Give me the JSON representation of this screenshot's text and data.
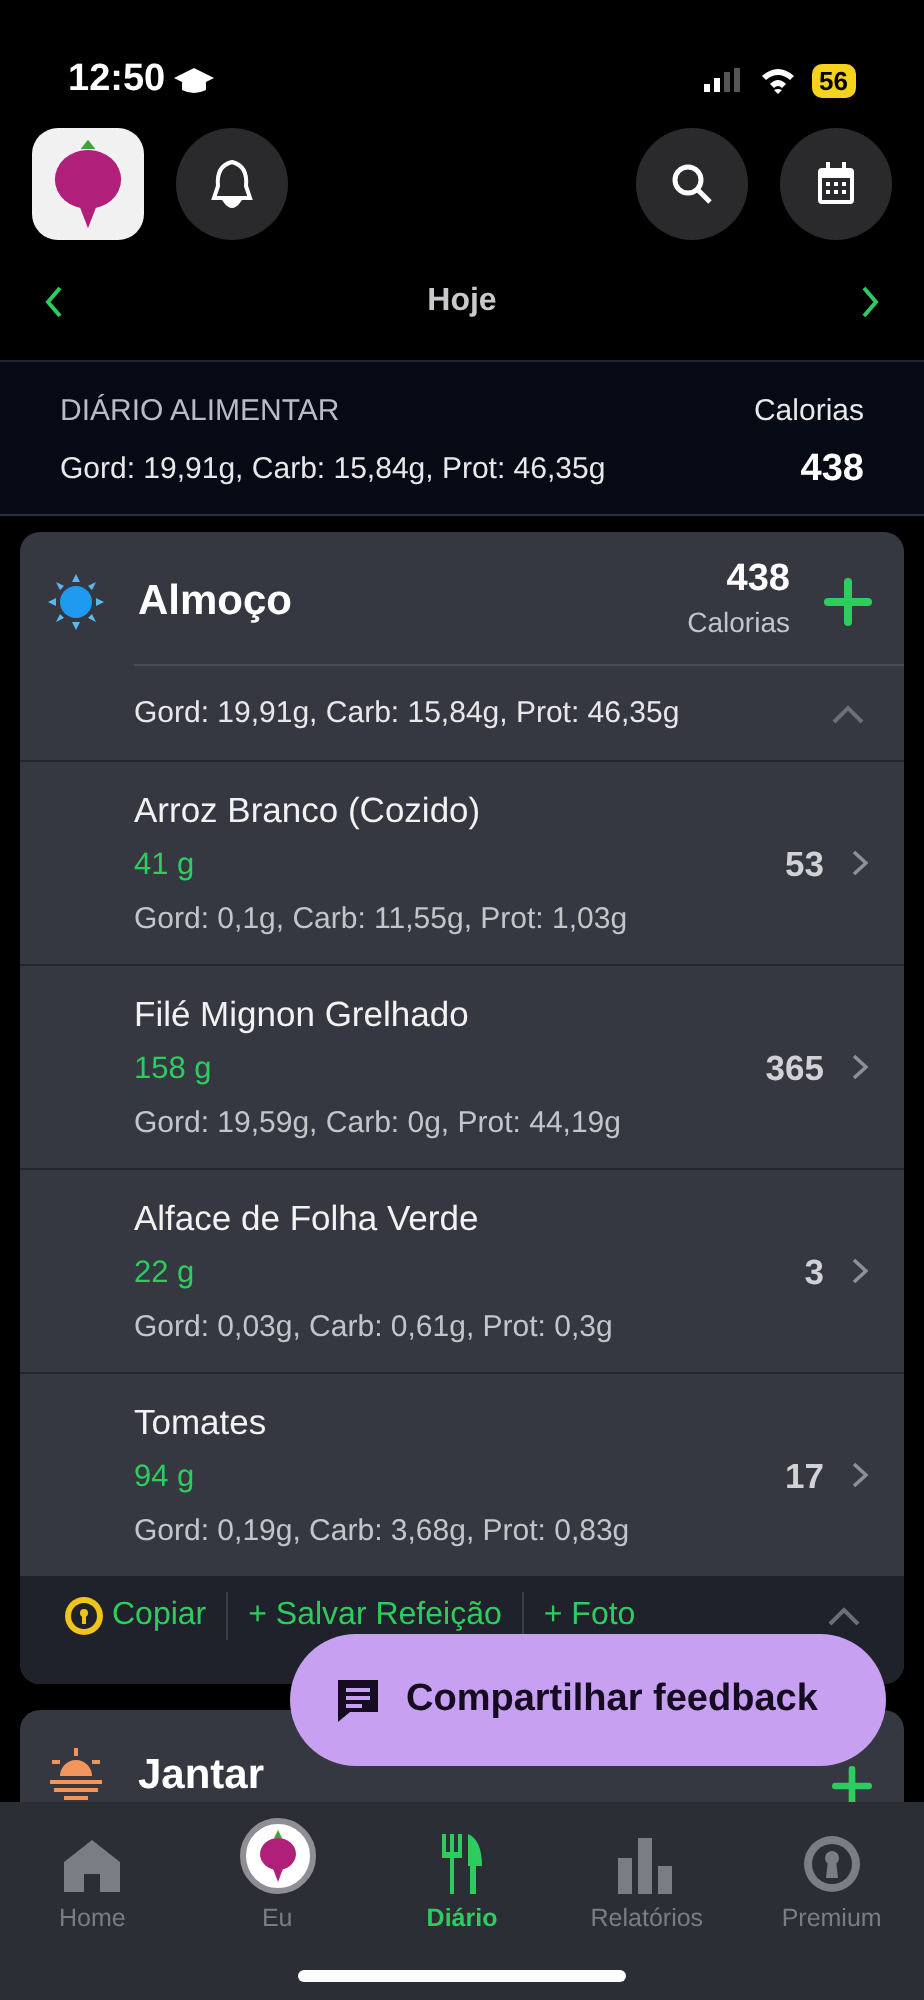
{
  "status_bar": {
    "time": "12:50",
    "battery": "56"
  },
  "date_nav": {
    "label": "Hoje"
  },
  "summary": {
    "title": "DIÁRIO ALIMENTAR",
    "macros": "Gord: 19,91g, Carb: 15,84g, Prot: 46,35g",
    "calories_label": "Calorias",
    "calories": "438"
  },
  "meals": [
    {
      "name": "Almoço",
      "kind": "lunch",
      "calories": "438",
      "calories_label": "Calorias",
      "expanded": true,
      "macros": "Gord: 19,91g, Carb: 15,84g, Prot: 46,35g",
      "foods": [
        {
          "name": "Arroz Branco (Cozido)",
          "amount": "41 g",
          "macros": "Gord: 0,1g, Carb: 11,55g, Prot: 1,03g",
          "calories": "53"
        },
        {
          "name": "Filé Mignon Grelhado",
          "amount": "158 g",
          "macros": "Gord: 19,59g, Carb: 0g, Prot: 44,19g",
          "calories": "365"
        },
        {
          "name": "Alface de Folha Verde",
          "amount": "22 g",
          "macros": "Gord: 0,03g, Carb: 0,61g, Prot: 0,3g",
          "calories": "3"
        },
        {
          "name": "Tomates",
          "amount": "94 g",
          "macros": "Gord: 0,19g, Carb: 3,68g, Prot: 0,83g",
          "calories": "17"
        }
      ],
      "actions": [
        "Copiar",
        "+ Salvar Refeição",
        "+ Foto"
      ]
    },
    {
      "name": "Jantar",
      "kind": "dinner",
      "expanded": false
    }
  ],
  "feedback_button": "Compartilhar feedback",
  "tabs": [
    {
      "label": "Home",
      "selected": false
    },
    {
      "label": "Eu",
      "selected": false
    },
    {
      "label": "Diário",
      "selected": true
    },
    {
      "label": "Relatórios",
      "selected": false
    },
    {
      "label": "Premium",
      "selected": false
    }
  ]
}
